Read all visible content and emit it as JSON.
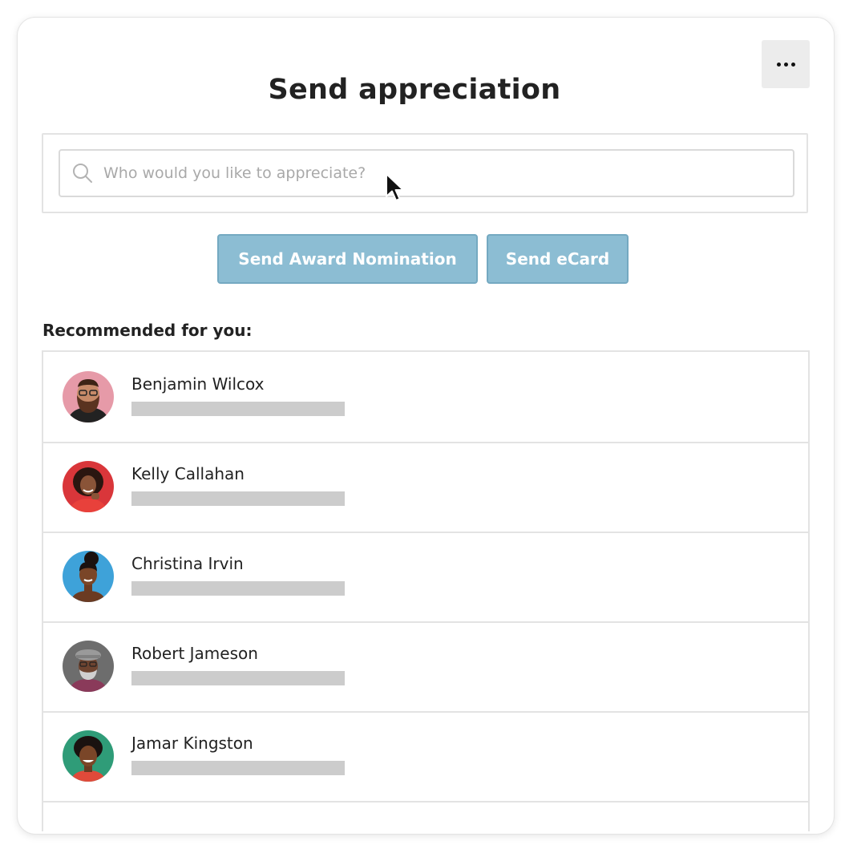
{
  "title": "Send appreciation",
  "more_menu": {
    "icon": "more-horizontal-icon"
  },
  "search": {
    "placeholder": "Who would you like to appreciate?",
    "icon": "search-icon"
  },
  "actions": {
    "award_label": "Send Award Nomination",
    "ecard_label": "Send eCard"
  },
  "colors": {
    "button_bg": "#8cbdd3",
    "button_border": "#74a9c1",
    "placeholder_bar": "#cccccc"
  },
  "recommended": {
    "label": "Recommended for you:",
    "people": [
      {
        "name": "Benjamin Wilcox",
        "avatar_bg": "#e69aa8"
      },
      {
        "name": "Kelly Callahan",
        "avatar_bg": "#d9363a"
      },
      {
        "name": "Christina Irvin",
        "avatar_bg": "#3ea2d9"
      },
      {
        "name": "Robert Jameson",
        "avatar_bg": "#6d6d6d"
      },
      {
        "name": "Jamar Kingston",
        "avatar_bg": "#2f9c78"
      }
    ]
  }
}
